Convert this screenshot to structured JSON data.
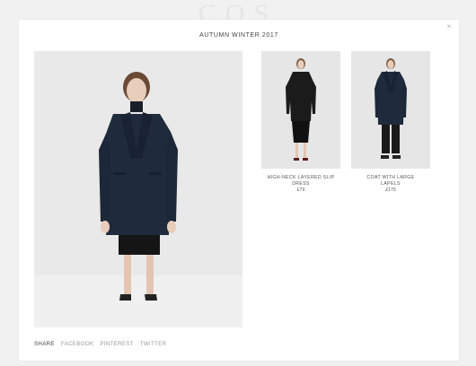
{
  "backdrop": {
    "logo_text": "COS"
  },
  "modal": {
    "title": "AUTUMN WINTER 2017",
    "close_label": "×"
  },
  "products": [
    {
      "name": "HIGH-NECK LAYERED SLIP DRESS",
      "price": "£79"
    },
    {
      "name": "COAT WITH LARGE LAPELS",
      "price": "£175"
    }
  ],
  "share": {
    "label": "SHARE",
    "links": [
      "FACEBOOK",
      "PINTEREST",
      "TWITTER"
    ]
  },
  "colors": {
    "navy_coat": "#1f2b3d",
    "black_dress": "#1b1b1b",
    "background_gray": "#e7e7e7"
  }
}
